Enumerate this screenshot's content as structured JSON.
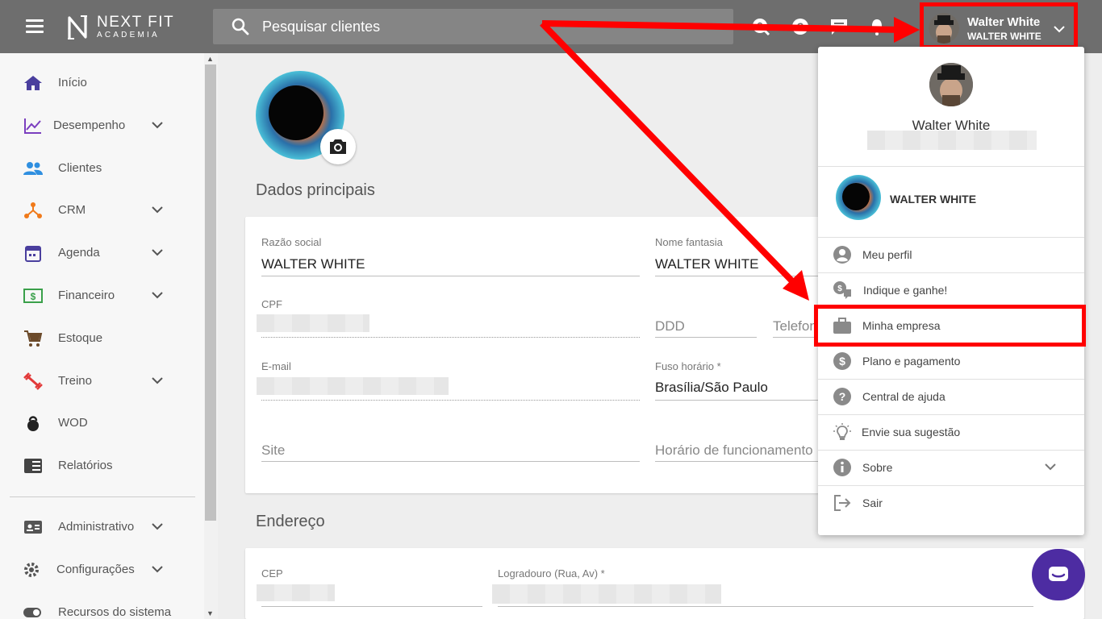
{
  "header": {
    "logo_main": "NEXT FIT",
    "logo_sub": "ACADEMIA",
    "search_placeholder": "Pesquisar clientes",
    "user_name": "Walter White",
    "user_company": "WALTER WHITE"
  },
  "sidebar": {
    "items": [
      {
        "label": "Início",
        "icon": "home-icon",
        "color": "#4a3f9e"
      },
      {
        "label": "Desempenho",
        "icon": "chart-icon",
        "color": "#7b3fbf"
      },
      {
        "label": "Clientes",
        "icon": "people-icon",
        "color": "#2f8fe0"
      },
      {
        "label": "CRM",
        "icon": "crm-icon",
        "color": "#f07a1a"
      },
      {
        "label": "Agenda",
        "icon": "calendar-icon",
        "color": "#4a3f9e"
      },
      {
        "label": "Financeiro",
        "icon": "dollar-icon",
        "color": "#3aa04a"
      },
      {
        "label": "Estoque",
        "icon": "cart-icon",
        "color": "#6b4a2a"
      },
      {
        "label": "Treino",
        "icon": "dumbbell-icon",
        "color": "#e23a3a"
      },
      {
        "label": "WOD",
        "icon": "kettlebell-icon",
        "color": "#222222"
      },
      {
        "label": "Relatórios",
        "icon": "report-icon",
        "color": "#444444"
      },
      {
        "label": "Administrativo",
        "icon": "id-card-icon",
        "color": "#555555"
      },
      {
        "label": "Configurações",
        "icon": "gear-icon",
        "color": "#555555"
      },
      {
        "label": "Recursos do sistema",
        "icon": "toggle-icon",
        "color": "#555555"
      }
    ]
  },
  "main": {
    "section_main": "Dados principais",
    "section_address": "Endereço",
    "fields": {
      "razao_label": "Razão social",
      "razao_value": "WALTER WHITE",
      "fantasia_label": "Nome fantasia",
      "fantasia_value": "WALTER WHITE",
      "cpf_label": "CPF",
      "ddd_placeholder": "DDD",
      "telefone_placeholder": "Telefone",
      "email_label": "E-mail",
      "fuso_label": "Fuso horário *",
      "fuso_value": "Brasília/São Paulo",
      "site_placeholder": "Site",
      "horario_placeholder": "Horário de funcionamento",
      "cep_label": "CEP",
      "logradouro_label": "Logradouro (Rua, Av) *"
    }
  },
  "dropdown": {
    "name": "Walter White",
    "company": "WALTER WHITE",
    "items": [
      {
        "label": "Meu perfil",
        "icon": "account-circle-icon"
      },
      {
        "label": "Indique e ganhe!",
        "icon": "referral-icon"
      },
      {
        "label": "Minha empresa",
        "icon": "briefcase-icon"
      },
      {
        "label": "Plano e pagamento",
        "icon": "dollar-circle-icon"
      },
      {
        "label": "Central de ajuda",
        "icon": "help-icon"
      },
      {
        "label": "Envie sua sugestão",
        "icon": "lightbulb-icon"
      },
      {
        "label": "Sobre",
        "icon": "info-icon"
      },
      {
        "label": "Sair",
        "icon": "logout-icon"
      }
    ]
  },
  "colors": {
    "topbar": "#6e6e6e",
    "highlight": "#ff0000",
    "chat": "#4d2ca2"
  }
}
